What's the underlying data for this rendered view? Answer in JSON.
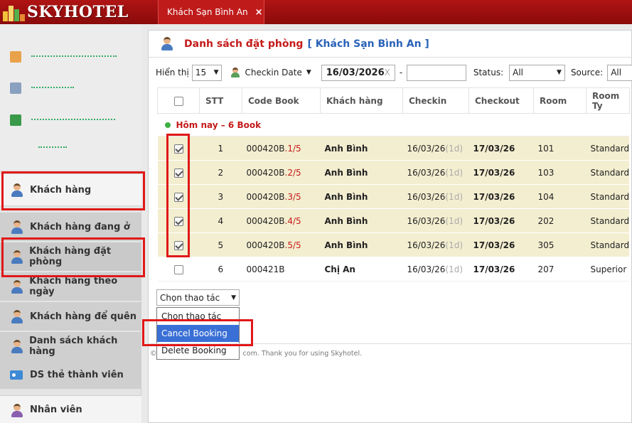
{
  "app": {
    "brand": "SKYHOTEL",
    "tab_label": "Khách Sạn Bình An",
    "tab_close": "×"
  },
  "sidebar": {
    "group_label": "Khách hàng",
    "items": [
      {
        "label": "Khách hàng đang ở"
      },
      {
        "label": "Khách hàng đặt phòng",
        "active": true
      },
      {
        "label": "Khách hàng theo ngày"
      },
      {
        "label": "Khách hàng để quên"
      },
      {
        "label": "Danh sách khách hàng"
      },
      {
        "label": "DS thẻ thành viên"
      }
    ],
    "bottom_label": "Nhân viên"
  },
  "header": {
    "title": "Danh sách đặt phòng",
    "hotel": "[ Khách Sạn Bình An ]"
  },
  "filters": {
    "show_label": "Hiển thị",
    "show_value": "15",
    "date_type": "Checkin Date",
    "date_from": "16/03/2026",
    "date_clear": "X",
    "dash": "-",
    "date_to": "",
    "status_label": "Status:",
    "status_value": "All",
    "source_label": "Source:",
    "source_value": "All"
  },
  "table": {
    "headers": [
      "STT",
      "Code Book",
      "Khách hàng",
      "Checkin",
      "Checkout",
      "Room",
      "Room Ty"
    ],
    "group_label": "Hôm nay – 6 Book",
    "rows": [
      {
        "stt": "1",
        "code": "000420B",
        "code_suffix": ".1/5",
        "guest": "Anh Bình",
        "checkin": "16/03/26",
        "nights": "(1d)",
        "checkout": "17/03/26",
        "room": "101",
        "room_type": "Standard",
        "checked": true,
        "today": true
      },
      {
        "stt": "2",
        "code": "000420B",
        "code_suffix": ".2/5",
        "guest": "Anh Bình",
        "checkin": "16/03/26",
        "nights": "(1d)",
        "checkout": "17/03/26",
        "room": "103",
        "room_type": "Standard",
        "checked": true,
        "today": true
      },
      {
        "stt": "3",
        "code": "000420B",
        "code_suffix": ".3/5",
        "guest": "Anh Bình",
        "checkin": "16/03/26",
        "nights": "(1d)",
        "checkout": "17/03/26",
        "room": "104",
        "room_type": "Standard",
        "checked": true,
        "today": true
      },
      {
        "stt": "4",
        "code": "000420B",
        "code_suffix": ".4/5",
        "guest": "Anh Bình",
        "checkin": "16/03/26",
        "nights": "(1d)",
        "checkout": "17/03/26",
        "room": "202",
        "room_type": "Standard",
        "checked": true,
        "today": true
      },
      {
        "stt": "5",
        "code": "000420B",
        "code_suffix": ".5/5",
        "guest": "Anh Bình",
        "checkin": "16/03/26",
        "nights": "(1d)",
        "checkout": "17/03/26",
        "room": "305",
        "room_type": "Standard",
        "checked": true,
        "today": true
      },
      {
        "stt": "6",
        "code": "000421B",
        "code_suffix": "",
        "guest": "Chị An",
        "checkin": "16/03/26",
        "nights": "(1d)",
        "checkout": "17/03/26",
        "room": "207",
        "room_type": "Superior",
        "checked": false,
        "today": false
      }
    ]
  },
  "actions": {
    "selected": "Chọn thao tác",
    "options": [
      "Chọn thao tác",
      "Cancel Booking",
      "Delete Booking"
    ],
    "highlighted_index": 1
  },
  "footer": {
    "text_prefix": "©",
    "text": "com. Thank you for using Skyhotel."
  },
  "colors": {
    "brand_red": "#b01414",
    "title_red": "#c51a1a",
    "link_blue": "#2a62b8",
    "today_row": "#f3eed0",
    "highlight": "#3a70d6"
  }
}
